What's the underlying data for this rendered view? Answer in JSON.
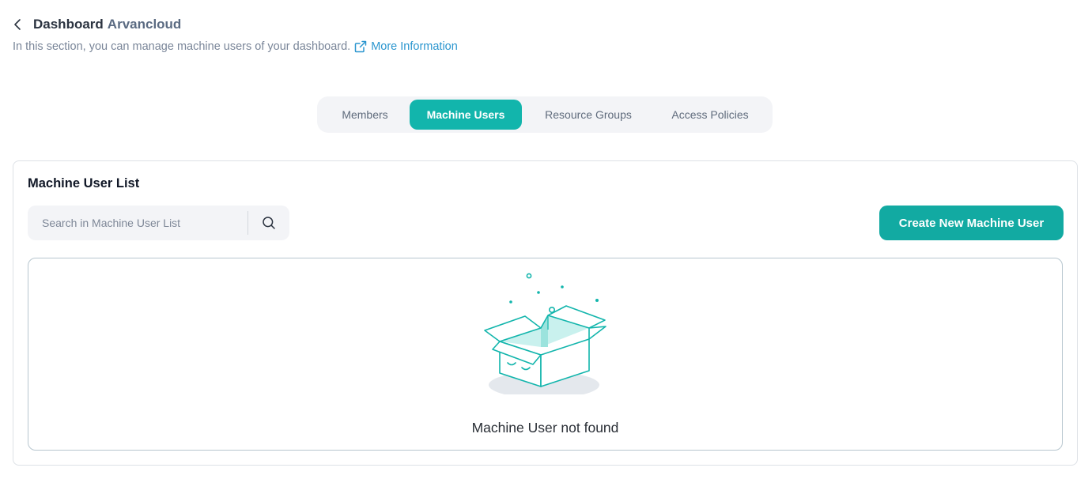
{
  "header": {
    "title": "Dashboard",
    "title_accent": "Arvancloud",
    "subtitle": "In this section, you can manage machine users of your dashboard.",
    "more_info_label": "More Information"
  },
  "tabs": [
    {
      "label": "Members",
      "active": false
    },
    {
      "label": "Machine Users",
      "active": true
    },
    {
      "label": "Resource Groups",
      "active": false
    },
    {
      "label": "Access Policies",
      "active": false
    }
  ],
  "card": {
    "title": "Machine User List",
    "search_placeholder": "Search in Machine User List",
    "create_button": "Create New Machine User",
    "empty_message": "Machine User not found"
  },
  "colors": {
    "accent": "#12b5ac",
    "link": "#2b96cf"
  },
  "icons": [
    "chevron-left-icon",
    "external-link-icon",
    "search-icon",
    "empty-box-illustration"
  ]
}
